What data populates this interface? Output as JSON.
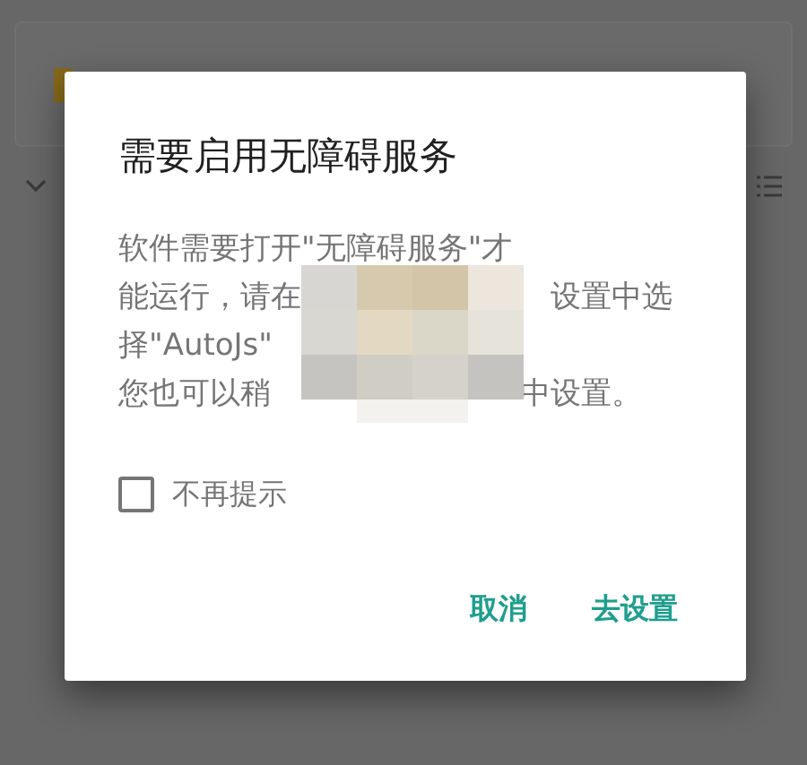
{
  "dialog": {
    "title": "需要启用无障碍服务",
    "message_lines": [
      {
        "parts": [
          "软件需要打开\"无障碍服务\"才"
        ]
      },
      {
        "parts": [
          "能运行，请在",
          "设置中选"
        ]
      },
      {
        "parts": [
          "择\"AutoJs\""
        ]
      },
      {
        "parts": [
          "您也可以稍",
          "中设置。"
        ]
      }
    ],
    "checkbox": {
      "label": "不再提示",
      "checked": false
    },
    "buttons": [
      {
        "label": "取消"
      },
      {
        "label": "去设置"
      }
    ]
  }
}
